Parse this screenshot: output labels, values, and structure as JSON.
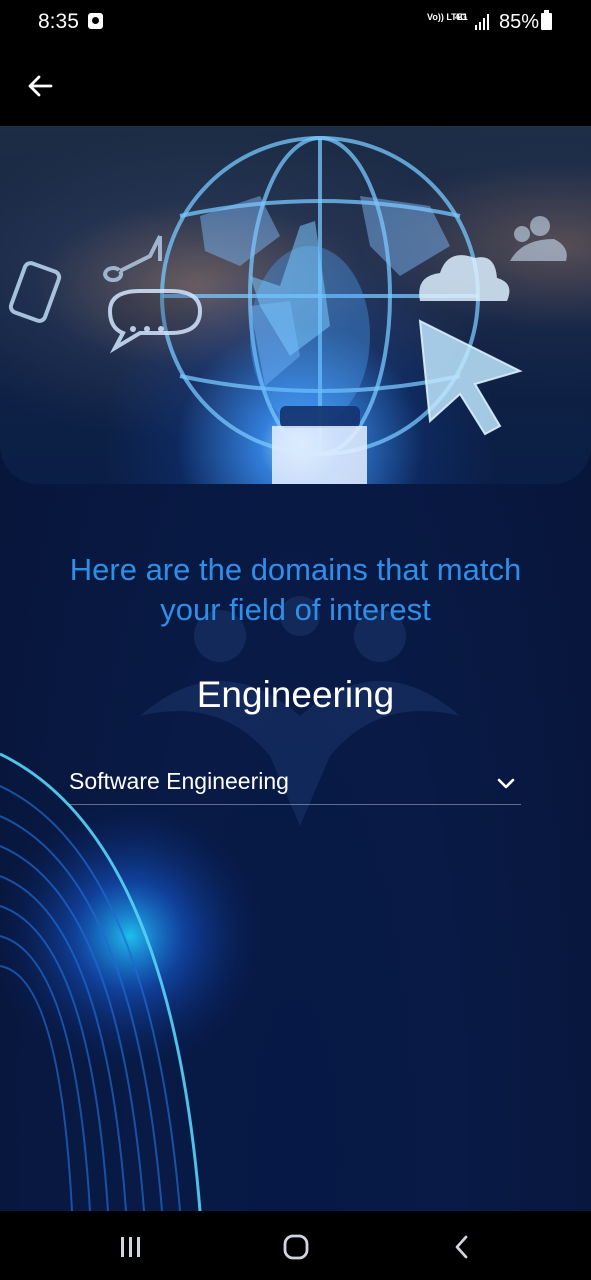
{
  "status_bar": {
    "time": "8:35",
    "network_label": "Vo)) LTE1",
    "network_type": "4G",
    "battery_percent": "85%",
    "icons": [
      "notification-icon",
      "signal-icon",
      "battery-icon"
    ]
  },
  "app_bar": {
    "back_icon": "arrow-left-icon"
  },
  "hero": {
    "image_description": "hand touching glowing globe with icons"
  },
  "main": {
    "intro_text": "Here are the domains that match your field of interest",
    "category": "Engineering",
    "domain_select": {
      "selected": "Software Engineering",
      "icon": "chevron-down-icon"
    }
  },
  "nav_bar": {
    "recents_icon": "recents-icon",
    "home_icon": "home-icon",
    "back_icon": "back-icon"
  },
  "colors": {
    "accent": "#2f8fe8",
    "background": "#071437",
    "bar": "#000000"
  }
}
